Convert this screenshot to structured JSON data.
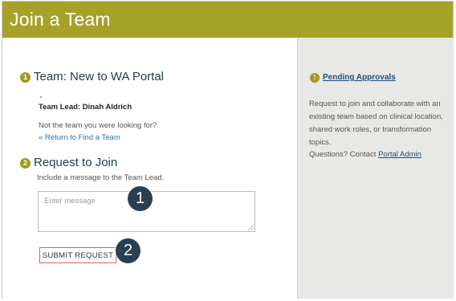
{
  "header": {
    "title": "Join a Team"
  },
  "team_section": {
    "step_number": "1",
    "title": "Team: New to WA Portal",
    "team_lead": "Team Lead: Dinah Aldrich",
    "not_looking": "Not the team you were looking for?",
    "return_link": "« Return to Find a Team"
  },
  "request_section": {
    "step_number": "2",
    "title": "Request to Join",
    "instruction": "Include a message to the Team Lead.",
    "message_placeholder": "Enter message",
    "submit_label": "SUBMIT REQUEST"
  },
  "callouts": [
    "1",
    "2"
  ],
  "sidebar": {
    "icon": "pending-approvals-icon",
    "pending_link": "Pending Approvals",
    "description": "Request to join and collaborate with an existing team based on clinical location, shared work roles, or transformation topics.",
    "questions_prefix": "Questions? Contact ",
    "admin_link": "Portal Admin"
  },
  "colors": {
    "header_bg": "#a6a229",
    "accent": "#a39a1e",
    "callout_bg": "#2b3f52",
    "submit_border": "#e0605a"
  }
}
